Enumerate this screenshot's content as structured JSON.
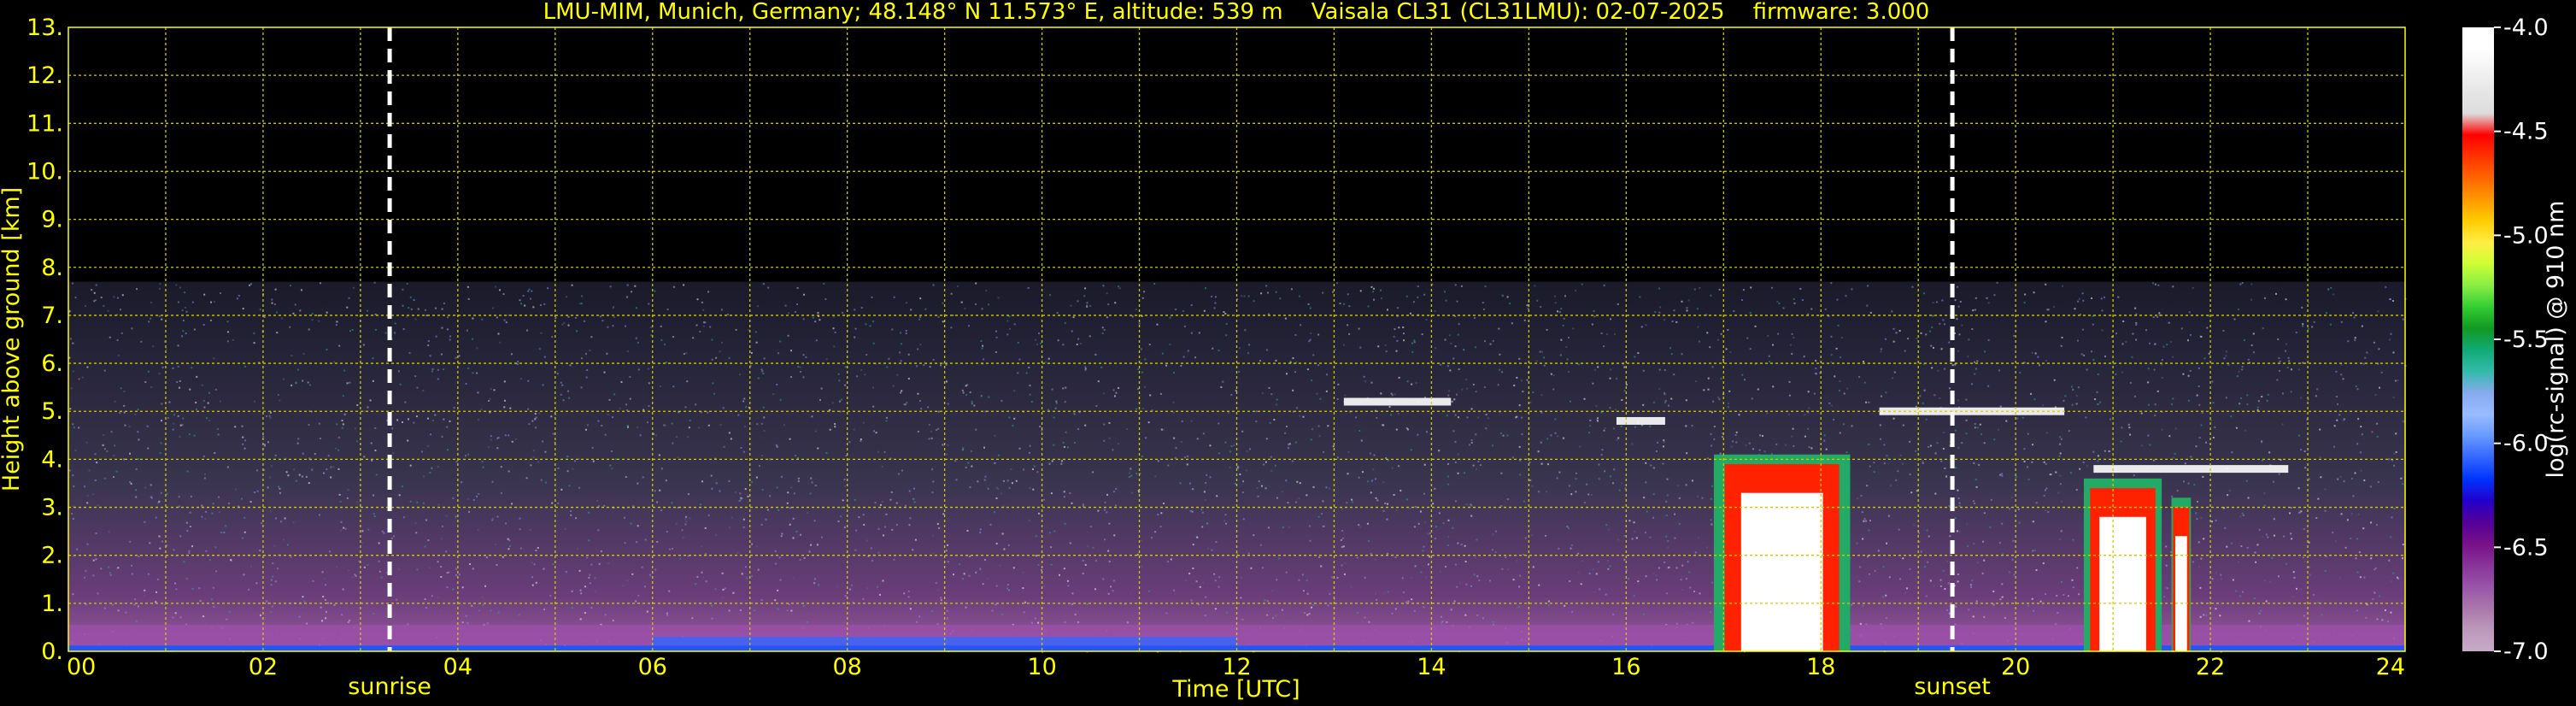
{
  "chart_data": {
    "type": "heatmap",
    "title": "LMU-MIM, Munich, Germany; 48.148° N 11.573° E, altitude: 539 m    Vaisala CL31 (CL31LMU): 02-07-2025    firmware: 3.000",
    "xlabel": "Time [UTC]",
    "ylabel": "Height above ground [km]",
    "xlim": [
      0,
      24
    ],
    "ylim": [
      0,
      13
    ],
    "x_ticks": [
      "00",
      "02",
      "04",
      "06",
      "08",
      "10",
      "12",
      "14",
      "16",
      "18",
      "20",
      "22",
      "24"
    ],
    "y_ticks": [
      "0.",
      "1.",
      "2.",
      "3.",
      "4.",
      "5.",
      "6.",
      "7.",
      "8.",
      "9.",
      "10.",
      "11.",
      "12.",
      "13."
    ],
    "grid": true,
    "markers": [
      {
        "label": "sunrise",
        "time": 3.3
      },
      {
        "label": "sunset",
        "time": 19.35
      }
    ],
    "colorbar": {
      "label": "log(rc-signal) @ 910 nm",
      "ticks": [
        "-4.0",
        "-4.5",
        "-5.0",
        "-5.5",
        "-6.0",
        "-6.5",
        "-7.0"
      ],
      "range": [
        -7.0,
        -4.0
      ],
      "colors": [
        "#ffffff",
        "#ffffff",
        "#f2f2f2",
        "#e6e6e6",
        "#dddddd",
        "#ff0000",
        "#ff3300",
        "#ff6600",
        "#ff9900",
        "#ffcc00",
        "#ffee44",
        "#ccff33",
        "#88ee44",
        "#33cc33",
        "#119922",
        "#11aa77",
        "#33bbaa",
        "#88aaee",
        "#99bbff",
        "#6699ff",
        "#3366ff",
        "#0033ff",
        "#2200cc",
        "#550099",
        "#771188",
        "#883399",
        "#9955aa",
        "#aa77aa",
        "#bb99bb",
        "#c8aac8"
      ]
    },
    "observation_top_km": 7.7,
    "cloud_layers": [
      {
        "start": 13.1,
        "end": 14.2,
        "height": 5.2
      },
      {
        "start": 15.9,
        "end": 16.4,
        "height": 4.8
      },
      {
        "start": 18.6,
        "end": 20.5,
        "height": 5.0
      },
      {
        "start": 20.8,
        "end": 22.8,
        "height": 3.8
      }
    ],
    "precip_columns": [
      {
        "start": 16.9,
        "end": 18.3,
        "top": 4.1
      },
      {
        "start": 20.7,
        "end": 21.5,
        "top": 3.6
      },
      {
        "start": 21.6,
        "end": 21.8,
        "top": 3.2
      }
    ]
  }
}
